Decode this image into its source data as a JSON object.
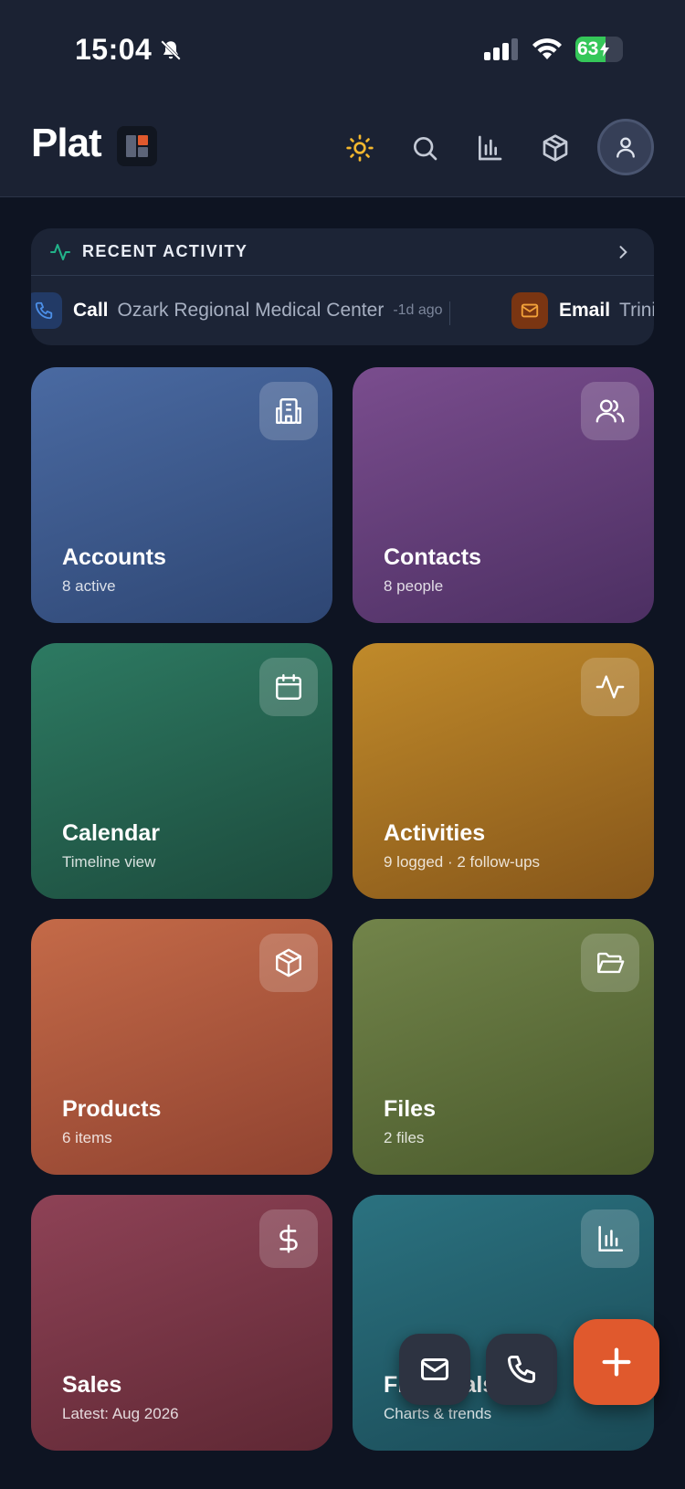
{
  "status_bar": {
    "time": "15:04",
    "battery": "63",
    "battery_fraction": 0.63
  },
  "header": {
    "logo": "Plat",
    "icons": [
      "sun-icon",
      "search-icon",
      "bar-chart-icon",
      "box-icon",
      "user-icon"
    ]
  },
  "recent_activity": {
    "title": "RECENT ACTIVITY",
    "items": [
      {
        "type": "Call",
        "name": "Ozark Regional Medical Center",
        "time": "-1d ago",
        "icon": "phone-icon"
      },
      {
        "type": "Email",
        "name": "Trinit",
        "icon": "mail-icon"
      }
    ]
  },
  "tiles": [
    {
      "title": "Accounts",
      "subtitle": "8 active",
      "icon": "building-icon"
    },
    {
      "title": "Contacts",
      "subtitle": "8 people",
      "icon": "users-icon"
    },
    {
      "title": "Calendar",
      "subtitle": "Timeline view",
      "icon": "calendar-icon"
    },
    {
      "title": "Activities",
      "subtitle": "9 logged · 2 follow-ups",
      "icon": "activity-icon"
    },
    {
      "title": "Products",
      "subtitle": "6 items",
      "icon": "box-icon"
    },
    {
      "title": "Files",
      "subtitle": "2 files",
      "icon": "folder-icon"
    },
    {
      "title": "Sales",
      "subtitle": "Latest: Aug 2026",
      "icon": "dollar-icon"
    },
    {
      "title": "Financials",
      "subtitle": "Charts & trends",
      "icon": "bar-chart-icon"
    }
  ],
  "fabs": [
    "mail-icon",
    "phone-icon",
    "plus-icon"
  ],
  "colors": {
    "background": "#0e1422",
    "accent": "#e0592d",
    "sun": "#f5b82e",
    "activity_green": "#22b38a"
  }
}
